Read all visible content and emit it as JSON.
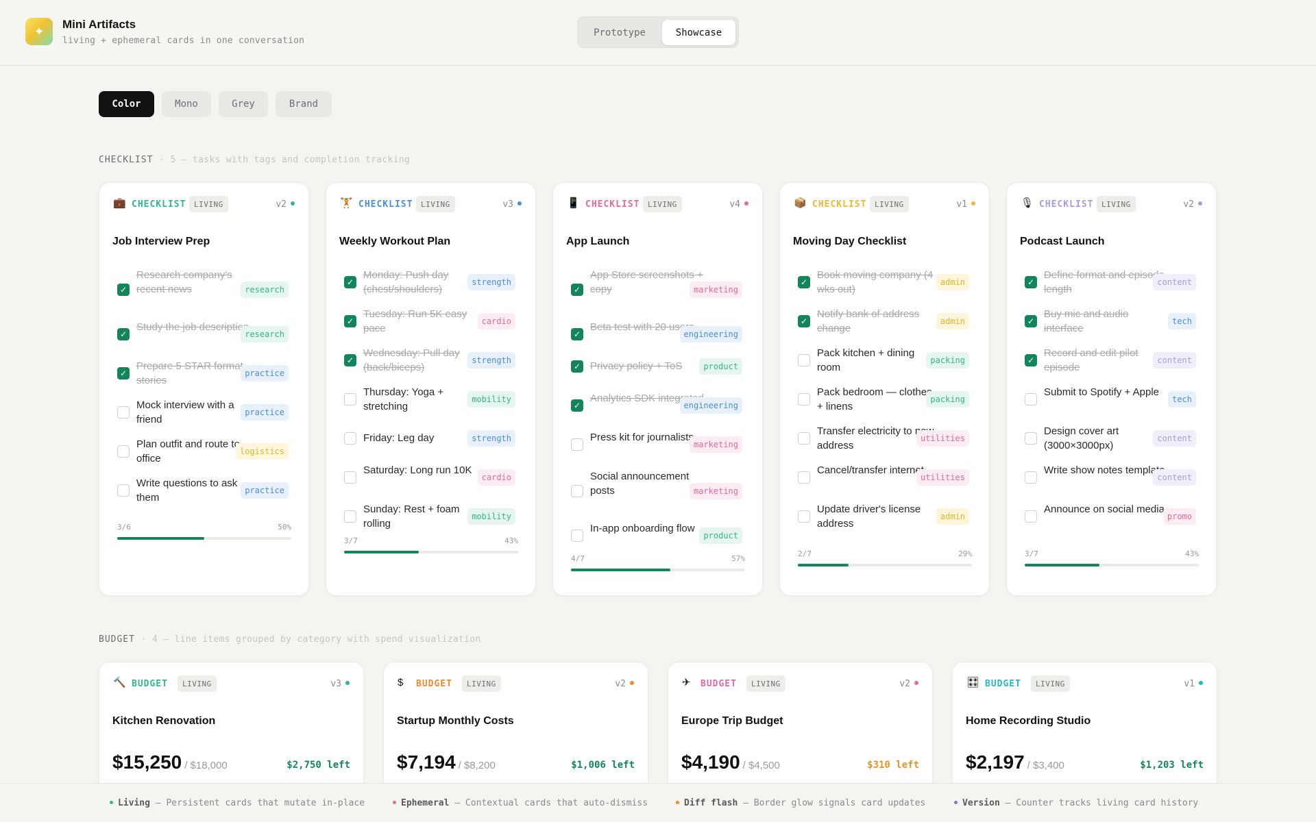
{
  "app": {
    "title": "Mini Artifacts",
    "subtitle": "living + ephemeral cards in one conversation",
    "logo_icon": "sparkle-icon"
  },
  "mode": {
    "options": [
      "Prototype",
      "Showcase"
    ],
    "selected": "Showcase"
  },
  "filters": {
    "options": [
      "Color",
      "Mono",
      "Grey",
      "Brand"
    ],
    "selected": "Color"
  },
  "sections": {
    "checklist": {
      "name": "CHECKLIST",
      "desc": "· 5 — tasks with tags and completion tracking"
    },
    "budget": {
      "name": "BUDGET",
      "desc": "· 4 — line items grouped by category with spend visualization"
    }
  },
  "checklists": [
    {
      "icon": "💼",
      "type": "CHECKLIST",
      "badge": "LIVING",
      "version": "v2",
      "accent": "#2fb98a",
      "title": "Job Interview Prep",
      "tasks": [
        {
          "text": "Research company's recent news",
          "done": true,
          "tag": "research"
        },
        {
          "text": "Study the job description",
          "done": true,
          "tag": "research"
        },
        {
          "text": "Prepare 5 STAR format stories",
          "done": true,
          "tag": "practice"
        },
        {
          "text": "Mock interview with a friend",
          "done": false,
          "tag": "practice"
        },
        {
          "text": "Plan outfit and route to office",
          "done": false,
          "tag": "logistics"
        },
        {
          "text": "Write questions to ask them",
          "done": false,
          "tag": "practice"
        }
      ],
      "progress_label": "3/6",
      "percent_label": "50%",
      "progress": 0.5
    },
    {
      "icon": "🏋",
      "type": "CHECKLIST",
      "badge": "LIVING",
      "version": "v3",
      "accent": "#4a8ee0",
      "title": "Weekly Workout Plan",
      "tasks": [
        {
          "text": "Monday: Push day (chest/shoulders)",
          "done": true,
          "tag": "strength"
        },
        {
          "text": "Tuesday: Run 5K easy pace",
          "done": true,
          "tag": "cardio"
        },
        {
          "text": "Wednesday: Pull day (back/biceps)",
          "done": true,
          "tag": "strength"
        },
        {
          "text": "Thursday: Yoga + stretching",
          "done": false,
          "tag": "mobility"
        },
        {
          "text": "Friday: Leg day",
          "done": false,
          "tag": "strength"
        },
        {
          "text": "Saturday: Long run 10K",
          "done": false,
          "tag": "cardio"
        },
        {
          "text": "Sunday: Rest + foam rolling",
          "done": false,
          "tag": "mobility"
        }
      ],
      "progress_label": "3/7",
      "percent_label": "43%",
      "progress": 0.43
    },
    {
      "icon": "📱",
      "type": "CHECKLIST",
      "badge": "LIVING",
      "version": "v4",
      "accent": "#e56a9a",
      "title": "App Launch",
      "tasks": [
        {
          "text": "App Store screenshots + copy",
          "done": true,
          "tag": "marketing"
        },
        {
          "text": "Beta test with 20 users",
          "done": true,
          "tag": "engineering"
        },
        {
          "text": "Privacy policy + ToS",
          "done": true,
          "tag": "product"
        },
        {
          "text": "Analytics SDK integrated",
          "done": true,
          "tag": "engineering"
        },
        {
          "text": "Press kit for journalists",
          "done": false,
          "tag": "marketing"
        },
        {
          "text": "Social announcement posts",
          "done": false,
          "tag": "marketing"
        },
        {
          "text": "In-app onboarding flow",
          "done": false,
          "tag": "product"
        }
      ],
      "progress_label": "4/7",
      "percent_label": "57%",
      "progress": 0.57
    },
    {
      "icon": "📦",
      "type": "CHECKLIST",
      "badge": "LIVING",
      "version": "v1",
      "accent": "#f0b92c",
      "title": "Moving Day Checklist",
      "tasks": [
        {
          "text": "Book moving company (4 wks out)",
          "done": true,
          "tag": "admin"
        },
        {
          "text": "Notify bank of address change",
          "done": true,
          "tag": "admin"
        },
        {
          "text": "Pack kitchen + dining room",
          "done": false,
          "tag": "packing"
        },
        {
          "text": "Pack bedroom — clothes + linens",
          "done": false,
          "tag": "packing"
        },
        {
          "text": "Transfer electricity to new address",
          "done": false,
          "tag": "utilities"
        },
        {
          "text": "Cancel/transfer internet",
          "done": false,
          "tag": "utilities"
        },
        {
          "text": "Update driver's license address",
          "done": false,
          "tag": "admin"
        }
      ],
      "progress_label": "2/7",
      "percent_label": "29%",
      "progress": 0.29
    },
    {
      "icon": "🎙",
      "type": "CHECKLIST",
      "badge": "LIVING",
      "version": "v2",
      "accent": "#a99be0",
      "title": "Podcast Launch",
      "tasks": [
        {
          "text": "Define format and episode length",
          "done": true,
          "tag": "content"
        },
        {
          "text": "Buy mic and audio interface",
          "done": true,
          "tag": "tech"
        },
        {
          "text": "Record and edit pilot episode",
          "done": true,
          "tag": "content"
        },
        {
          "text": "Submit to Spotify + Apple",
          "done": false,
          "tag": "tech"
        },
        {
          "text": "Design cover art (3000×3000px)",
          "done": false,
          "tag": "content"
        },
        {
          "text": "Write show notes template",
          "done": false,
          "tag": "content"
        },
        {
          "text": "Announce on social media",
          "done": false,
          "tag": "promo"
        }
      ],
      "progress_label": "3/7",
      "percent_label": "43%",
      "progress": 0.43
    }
  ],
  "tag_colors": {
    "research": {
      "bg": "#e6f6ee",
      "fg": "#2fb98a"
    },
    "practice": {
      "bg": "#e7f0fb",
      "fg": "#4a8ee0"
    },
    "logistics": {
      "bg": "#fdf6dc",
      "fg": "#e3b528"
    },
    "strength": {
      "bg": "#e7f0fb",
      "fg": "#4a8ee0"
    },
    "cardio": {
      "bg": "#fdecf2",
      "fg": "#e56a9a"
    },
    "mobility": {
      "bg": "#e6f6ee",
      "fg": "#2fb98a"
    },
    "marketing": {
      "bg": "#fdecf2",
      "fg": "#e56a9a"
    },
    "engineering": {
      "bg": "#e7f0fb",
      "fg": "#4a8ee0"
    },
    "product": {
      "bg": "#e6f6ee",
      "fg": "#2fb98a"
    },
    "admin": {
      "bg": "#fdf6dc",
      "fg": "#e3b528"
    },
    "packing": {
      "bg": "#e6f6ee",
      "fg": "#2fb98a"
    },
    "utilities": {
      "bg": "#fdecf2",
      "fg": "#e56a9a"
    },
    "content": {
      "bg": "#f1eefb",
      "fg": "#a99be0"
    },
    "tech": {
      "bg": "#e7f0fb",
      "fg": "#4a8ee0"
    },
    "promo": {
      "bg": "#fdecf2",
      "fg": "#e56a9a"
    }
  },
  "budgets": [
    {
      "icon": "🔨",
      "type": "BUDGET",
      "badge": "LIVING",
      "version": "v3",
      "accent": "#2fb98a",
      "title": "Kitchen Renovation",
      "spent": "$15,250",
      "total": "/ $18,000",
      "left": "$2,750 left",
      "left_color": "#12865a"
    },
    {
      "icon": "$",
      "type": "BUDGET",
      "badge": "LIVING",
      "version": "v2",
      "accent": "#ef8a2c",
      "title": "Startup Monthly Costs",
      "spent": "$7,194",
      "total": "/ $8,200",
      "left": "$1,006 left",
      "left_color": "#12865a"
    },
    {
      "icon": "✈",
      "type": "BUDGET",
      "badge": "LIVING",
      "version": "v2",
      "accent": "#e56a9a",
      "title": "Europe Trip Budget",
      "spent": "$4,190",
      "total": "/ $4,500",
      "left": "$310 left",
      "left_color": "#e0952a"
    },
    {
      "icon": "🎛",
      "type": "BUDGET",
      "badge": "LIVING",
      "version": "v1",
      "accent": "#22b7c9",
      "title": "Home Recording Studio",
      "spent": "$2,197",
      "total": "/ $3,400",
      "left": "$1,203 left",
      "left_color": "#12865a"
    }
  ],
  "legend": [
    {
      "name": "Living",
      "desc": "— Persistent cards that mutate in-place",
      "color": "#2fb98a"
    },
    {
      "name": "Ephemeral",
      "desc": "— Contextual cards that auto-dismiss",
      "color": "#e56a9a"
    },
    {
      "name": "Diff flash",
      "desc": "— Border glow signals card updates",
      "color": "#ef8a2c"
    },
    {
      "name": "Version",
      "desc": "— Counter tracks living card history",
      "color": "#8a6fe0"
    }
  ]
}
